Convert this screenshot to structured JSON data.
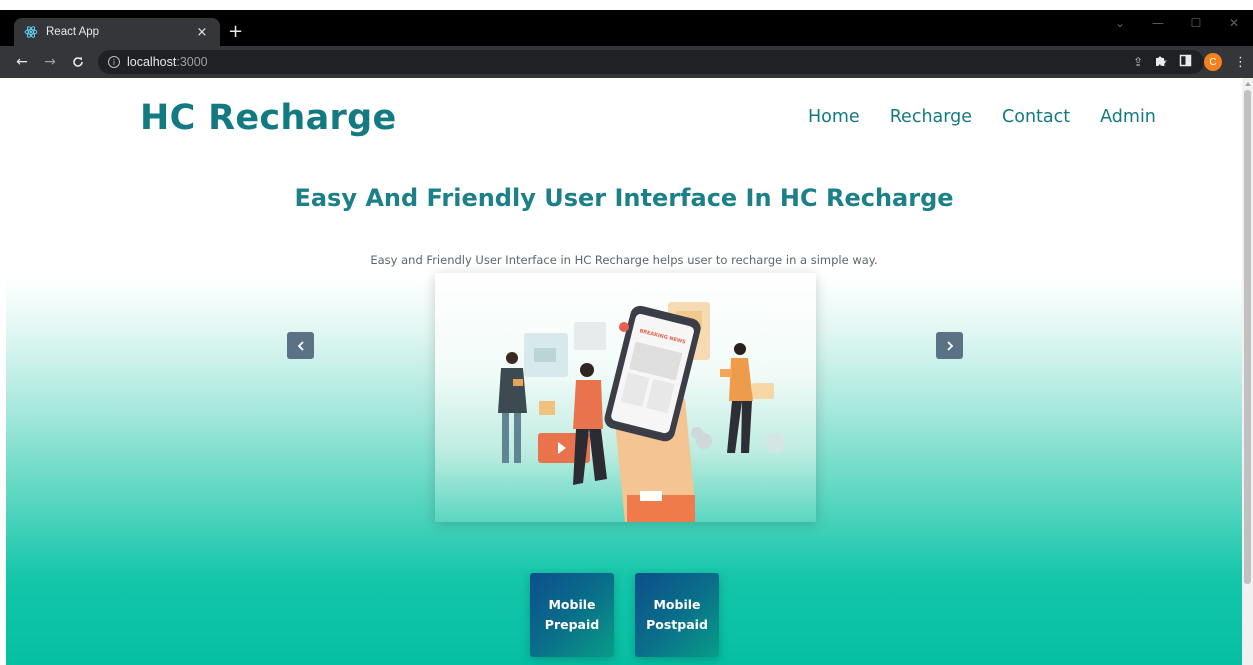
{
  "browser": {
    "tab_title": "React App",
    "tab_close": "×",
    "new_tab": "+",
    "url_host": "localhost",
    "url_port": ":3000",
    "profile_initial": "C"
  },
  "site": {
    "brand": "HC Recharge",
    "nav": [
      "Home",
      "Recharge",
      "Contact",
      "Admin"
    ]
  },
  "hero": {
    "headline": "Easy And Friendly User Interface In HC Recharge",
    "subline": "Easy and Friendly User Interface in HC Recharge helps user to recharge in a simple way.",
    "slide_illustration_text": "BREAKING NEWS"
  },
  "actions": [
    {
      "line1": "Mobile",
      "line2": "Prepaid"
    },
    {
      "line1": "Mobile",
      "line2": "Postpaid"
    }
  ],
  "colors": {
    "brand": "#127a80",
    "button_gradient_start": "#0d4f8c",
    "button_gradient_end": "#099d87",
    "page_bottom": "#05bfa3"
  }
}
